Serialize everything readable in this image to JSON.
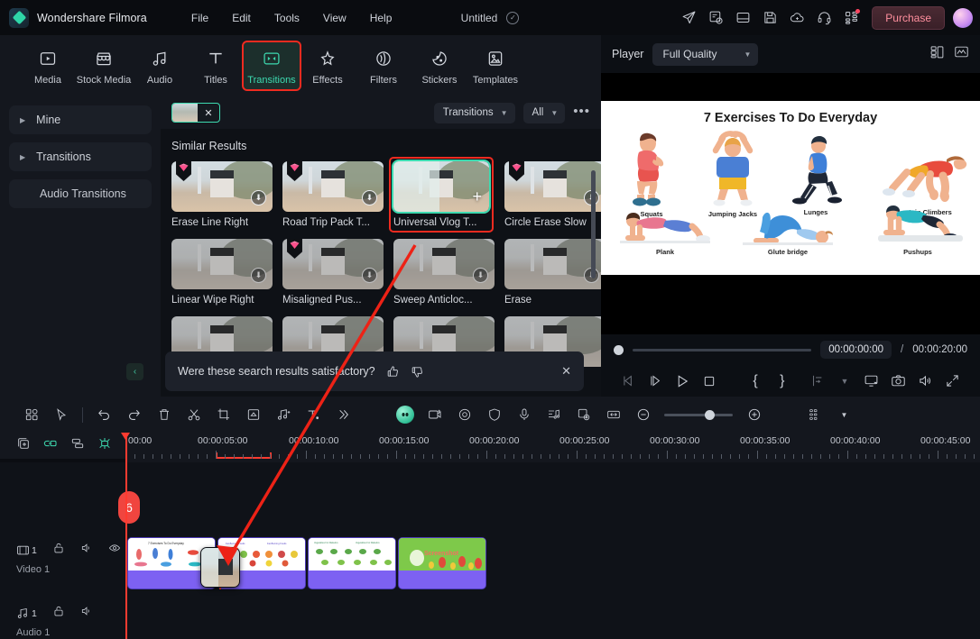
{
  "app": {
    "name": "Wondershare Filmora",
    "document_title": "Untitled",
    "logo_icon": "filmora-diamond-logo"
  },
  "menubar": {
    "items": [
      "File",
      "Edit",
      "Tools",
      "View",
      "Help"
    ]
  },
  "titlebar_icons": [
    {
      "name": "share-export-icon",
      "glyph": "send"
    },
    {
      "name": "render-preview-icon",
      "glyph": "render"
    },
    {
      "name": "layout-icon",
      "glyph": "layout"
    },
    {
      "name": "save-icon",
      "glyph": "save"
    },
    {
      "name": "cloud-upload-icon",
      "glyph": "cloud"
    },
    {
      "name": "support-headset-icon",
      "glyph": "headset"
    },
    {
      "name": "apps-grid-icon",
      "glyph": "grid",
      "has_badge": true
    }
  ],
  "purchase": {
    "label": "Purchase"
  },
  "media_tabs": [
    {
      "label": "Media",
      "icon": "media-icon",
      "active": false
    },
    {
      "label": "Stock Media",
      "icon": "stock-media-icon",
      "active": false
    },
    {
      "label": "Audio",
      "icon": "audio-note-icon",
      "active": false
    },
    {
      "label": "Titles",
      "icon": "titles-T-icon",
      "active": false
    },
    {
      "label": "Transitions",
      "icon": "transitions-icon",
      "active": true,
      "highlighted": true
    },
    {
      "label": "Effects",
      "icon": "effects-sparkle-icon",
      "active": false
    },
    {
      "label": "Filters",
      "icon": "filters-icon",
      "active": false
    },
    {
      "label": "Stickers",
      "icon": "stickers-icon",
      "active": false
    },
    {
      "label": "Templates",
      "icon": "templates-icon",
      "active": false
    }
  ],
  "sidebar": {
    "items": [
      {
        "label": "Mine",
        "expandable": true
      },
      {
        "label": "Transitions",
        "expandable": true
      },
      {
        "label": "Audio Transitions",
        "expandable": false
      }
    ]
  },
  "browser": {
    "search_chip": {
      "name": "image-search-chip",
      "close_label": "✕"
    },
    "filters": [
      {
        "label": "Transitions",
        "name": "category-filter"
      },
      {
        "label": "All",
        "name": "type-filter"
      }
    ],
    "more_label": "•••",
    "section_title": "Similar Results",
    "results": [
      {
        "label": "Erase Line Right",
        "pro": true,
        "downloadable": true,
        "selected": false
      },
      {
        "label": "Road Trip Pack T...",
        "pro": true,
        "downloadable": true,
        "selected": false
      },
      {
        "label": "Universal Vlog T...",
        "pro": false,
        "downloadable": false,
        "selected": true,
        "highlighted": true
      },
      {
        "label": "Circle Erase Slow",
        "pro": true,
        "downloadable": true,
        "selected": false
      },
      {
        "label": "Linear Wipe Right",
        "pro": false,
        "downloadable": true,
        "selected": false
      },
      {
        "label": "Misaligned Pus...",
        "pro": true,
        "downloadable": true,
        "selected": false
      },
      {
        "label": "Sweep Anticloc...",
        "pro": false,
        "downloadable": true,
        "selected": false
      },
      {
        "label": "Erase",
        "pro": false,
        "downloadable": true,
        "selected": false
      }
    ],
    "feedback": {
      "question": "Were these search results satisfactory?",
      "thumbs_up": "thumbs-up-icon",
      "thumbs_down": "thumbs-down-icon",
      "close": "✕"
    },
    "collapse_label": "‹"
  },
  "player": {
    "label": "Player",
    "quality": "Full Quality",
    "right_icons": [
      {
        "name": "split-view-icon"
      },
      {
        "name": "waveform-icon"
      }
    ],
    "current_time": "00:00:00:00",
    "separator": "/",
    "total_time": "00:00:20:00",
    "controls": [
      {
        "name": "prev-frame-button",
        "disabled": true
      },
      {
        "name": "next-frame-button",
        "disabled": false
      },
      {
        "name": "play-button",
        "disabled": false
      },
      {
        "name": "stop-button",
        "disabled": false
      },
      {
        "name": "mark-in-button",
        "label": "{"
      },
      {
        "name": "mark-out-button",
        "label": "}"
      },
      {
        "name": "export-frame-button",
        "disabled": true
      },
      {
        "name": "more-chevron-button"
      },
      {
        "name": "display-mode-button"
      },
      {
        "name": "snapshot-camera-button"
      },
      {
        "name": "volume-button"
      },
      {
        "name": "fullscreen-button"
      }
    ],
    "preview": {
      "title": "7 Exercises To Do Everyday",
      "exercises": [
        {
          "name": "Squats"
        },
        {
          "name": "Jumping Jacks"
        },
        {
          "name": "Lunges"
        },
        {
          "name": "Mountain Climbers"
        },
        {
          "name": "Plank"
        },
        {
          "name": "Glute bridge"
        },
        {
          "name": "Pushups"
        }
      ]
    }
  },
  "timeline_toolbar": {
    "left_tools": [
      {
        "name": "grid-view-button"
      },
      {
        "name": "select-cursor-button"
      },
      {
        "name": "undo-button"
      },
      {
        "name": "redo-button"
      },
      {
        "name": "delete-button"
      },
      {
        "name": "split-scissors-button"
      },
      {
        "name": "crop-button"
      },
      {
        "name": "speed-button"
      },
      {
        "name": "audio-detach-button"
      },
      {
        "name": "text-button"
      },
      {
        "name": "more-chevrons-button"
      }
    ],
    "right_tools": [
      {
        "name": "ai-tools-orb-button"
      },
      {
        "name": "green-screen-button"
      },
      {
        "name": "motion-tracking-button"
      },
      {
        "name": "stabilize-shield-button"
      },
      {
        "name": "voiceover-mic-button"
      },
      {
        "name": "audio-mixer-button"
      },
      {
        "name": "auto-reframe-button"
      },
      {
        "name": "fit-timeline-button"
      },
      {
        "name": "zoom-out-button"
      },
      {
        "name": "zoom-slider"
      },
      {
        "name": "zoom-in-button"
      },
      {
        "name": "timeline-options-button"
      },
      {
        "name": "timeline-options-chevron"
      }
    ]
  },
  "timeline": {
    "head_icons": [
      {
        "name": "add-track-button",
        "active": false
      },
      {
        "name": "link-clips-button",
        "active": true
      },
      {
        "name": "align-button",
        "active": false
      },
      {
        "name": "markers-button",
        "active": true
      }
    ],
    "ruler_ticks": [
      "00:00",
      "00:00:05:00",
      "00:00:10:00",
      "00:00:15:00",
      "00:00:20:00",
      "00:00:25:00",
      "00:00:30:00",
      "00:00:35:00",
      "00:00:40:00",
      "00:00:45:00"
    ],
    "tracks": [
      {
        "name": "Video 1",
        "number": "1",
        "icons": [
          "video-track-icon",
          "lock-icon",
          "mute-icon",
          "eye-icon"
        ]
      },
      {
        "name": "Audio 1",
        "number": "1",
        "icons": [
          "audio-track-icon",
          "lock-icon",
          "mute-icon"
        ]
      }
    ],
    "clips": [
      {
        "name": "clip-1"
      },
      {
        "name": "clip-2"
      },
      {
        "name": "clip-3"
      },
      {
        "name": "clip-4",
        "overlay_text": "Screenshot"
      }
    ],
    "drag_badge": "6"
  },
  "colors": {
    "accent_green": "#3ddab0",
    "annotation_red": "#ef2b20",
    "playhead_red": "#ff3b30",
    "clip_purple": "#7b5cf0",
    "purchase_pink": "#ff8f9e"
  }
}
